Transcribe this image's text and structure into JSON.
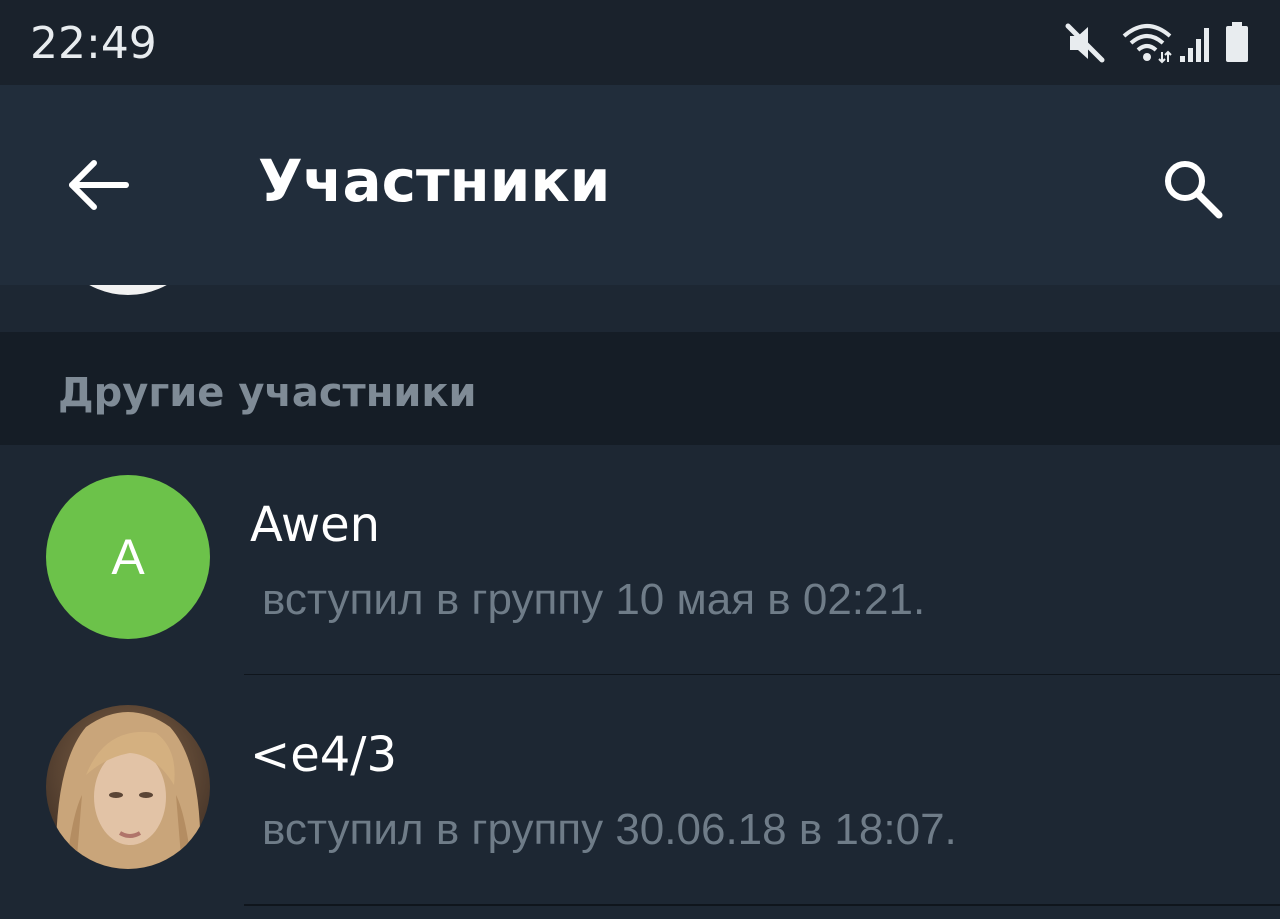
{
  "status_bar": {
    "time": "22:49",
    "icons": [
      "mute-icon",
      "wifi-icon",
      "signal-icon",
      "battery-icon"
    ]
  },
  "app_bar": {
    "title": "Участники",
    "back_icon": "back-arrow-icon",
    "search_icon": "search-icon"
  },
  "section": {
    "title": "Другие участники"
  },
  "members": [
    {
      "name": "Awen",
      "status": "вступил в группу 10 мая в 02:21.",
      "avatar_letter": "A",
      "avatar_color": "#6cc24a"
    },
    {
      "name": "<e4/3",
      "status": "вступил в группу 30.06.18 в 18:07.",
      "avatar_type": "photo"
    }
  ],
  "colors": {
    "background": "#1d2733",
    "app_bar": "#212d3b",
    "section_header": "#151d26",
    "secondary_text": "#6f7c88"
  }
}
